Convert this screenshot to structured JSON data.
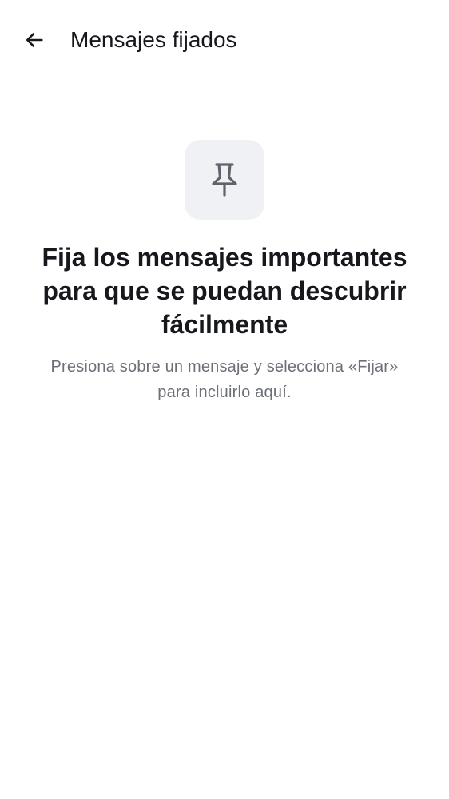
{
  "header": {
    "back_icon": "arrow-left-icon",
    "title": "Mensajes fijados"
  },
  "empty_state": {
    "icon": "pin-icon",
    "heading": "Fija los mensajes importantes para que se puedan descubrir fácilmente",
    "description": "Presiona sobre un mensaje y selecciona «Fijar» para incluirlo aquí."
  },
  "colors": {
    "background": "#ffffff",
    "text_primary": "#16181d",
    "text_secondary": "#6d7079",
    "icon_tile_background": "#f0f1f4",
    "icon_color": "#5f636c"
  }
}
